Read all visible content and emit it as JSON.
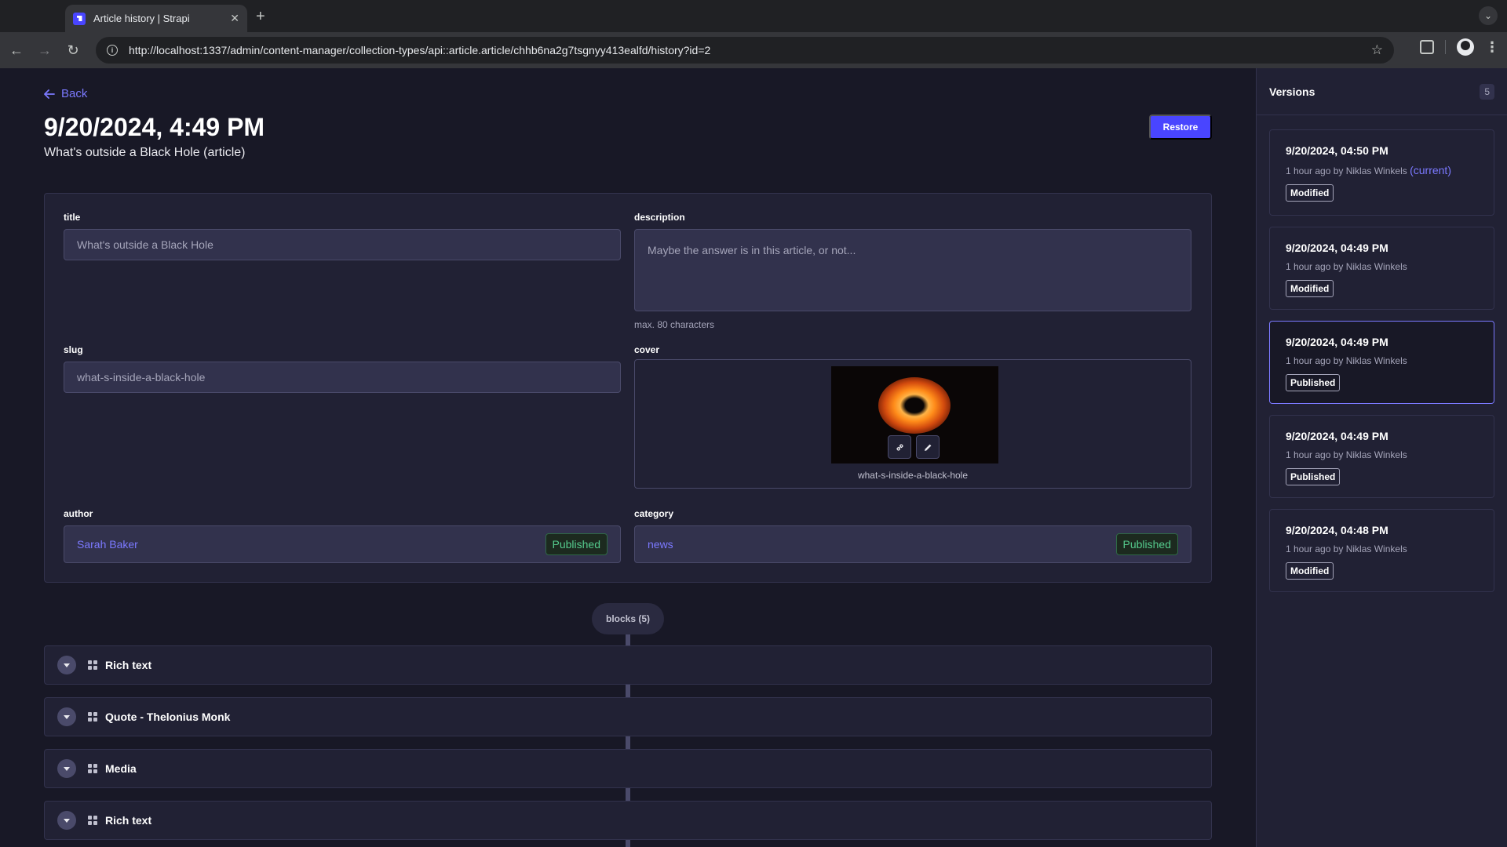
{
  "browser": {
    "tab_title": "Article history | Strapi",
    "url": "http://localhost:1337/admin/content-manager/collection-types/api::article.article/chhb6na2g7tsgnyy413ealfd/history?id=2"
  },
  "header": {
    "back_label": "Back",
    "title": "9/20/2024, 4:49 PM",
    "subtitle": "What's outside a Black Hole (article)",
    "restore_label": "Restore"
  },
  "form": {
    "title_label": "title",
    "title_value": "What's outside a Black Hole",
    "description_label": "description",
    "description_value": "Maybe the answer is in this article, or not...",
    "description_hint": "max. 80 characters",
    "slug_label": "slug",
    "slug_value": "what-s-inside-a-black-hole",
    "cover_label": "cover",
    "cover_name": "what-s-inside-a-black-hole",
    "author_label": "author",
    "author_value": "Sarah Baker",
    "author_status": "Published",
    "category_label": "category",
    "category_value": "news",
    "category_status": "Published"
  },
  "blocks": {
    "label": "blocks (5)",
    "items": [
      "Rich text",
      "Quote - Thelonius Monk",
      "Media",
      "Rich text"
    ]
  },
  "versions": {
    "title": "Versions",
    "count": "5",
    "current_label": "(current)",
    "items": [
      {
        "date": "9/20/2024, 04:50 PM",
        "meta": "1 hour ago by Niklas Winkels",
        "status": "Modified"
      },
      {
        "date": "9/20/2024, 04:49 PM",
        "meta": "1 hour ago by Niklas Winkels",
        "status": "Modified"
      },
      {
        "date": "9/20/2024, 04:49 PM",
        "meta": "1 hour ago by Niklas Winkels",
        "status": "Published"
      },
      {
        "date": "9/20/2024, 04:49 PM",
        "meta": "1 hour ago by Niklas Winkels",
        "status": "Published"
      },
      {
        "date": "9/20/2024, 04:48 PM",
        "meta": "1 hour ago by Niklas Winkels",
        "status": "Modified"
      }
    ]
  },
  "colors": {
    "accent": "#4945ff",
    "link": "#7b79ff",
    "published": "#55cb8d",
    "background": "#181826",
    "surface": "#212134"
  }
}
